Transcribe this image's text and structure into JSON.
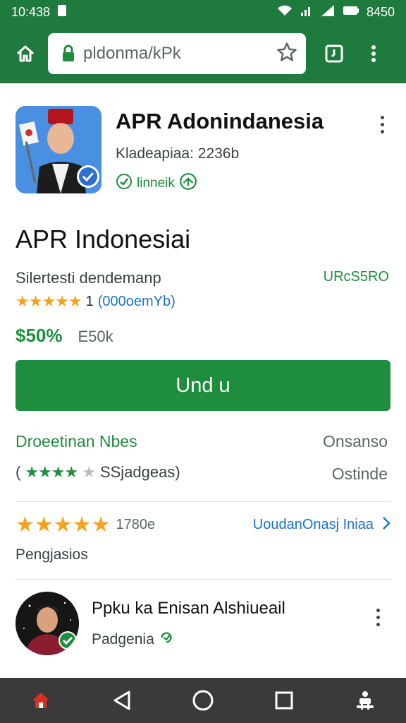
{
  "status_bar": {
    "time": "10:438",
    "right_text": "8450",
    "icons": [
      "sim-icon",
      "wifi-icon",
      "signal-icon",
      "signal-icon",
      "battery-icon"
    ]
  },
  "toolbar": {
    "url": "pldonma/kPk",
    "icons": [
      "home-icon",
      "lock-icon",
      "star-icon",
      "tab-icon",
      "more-vert-icon"
    ]
  },
  "app": {
    "title": "APR Adonindanesia",
    "developer": "Kladeapiaa: 2236b",
    "badge": "linneik"
  },
  "page": {
    "title": "APR Indonesiai",
    "subtitle": "Silertesti dendemanp",
    "subtitle_right": "URcS5RO",
    "stars": "★★★★★",
    "rating_value": "1",
    "rating_link": "(000oemYb)",
    "price": "$50%",
    "price_old": "E50k",
    "install_label": "Und u"
  },
  "info": {
    "row1_left": "Droeetinan Nbes",
    "row1_right": "Onsanso",
    "row2_open": "(",
    "row2_stars_green": "★★★★",
    "row2_star_grey": "★",
    "row2_text": "SSjadgeas)",
    "row2_right": "Ostinde"
  },
  "reviews": {
    "stars": "★★★★★",
    "count": "1780e",
    "link": "UoudanOnasj Iniaa",
    "label": "Pengjasios"
  },
  "developer_card": {
    "name": "Ppku ka Enisan Alshiueail",
    "sub": "Padgenia"
  },
  "colors": {
    "brand_green": "#1f7a3d",
    "button_green": "#1e8e3e",
    "link_blue": "#1a73c9",
    "star_orange": "#f4a21c",
    "nav_bar": "#3a3a3a"
  }
}
